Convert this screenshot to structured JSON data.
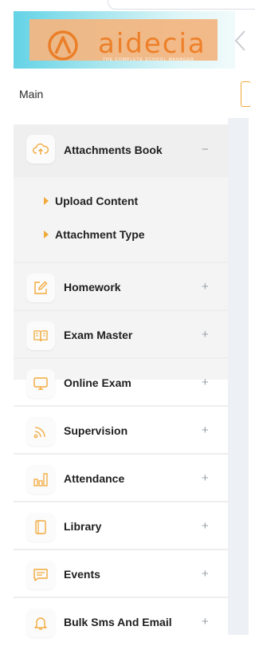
{
  "brand": {
    "name": "aidecia",
    "tagline": "THE COMPLETE SCHOOL MANAGER"
  },
  "main": {
    "label": "Main"
  },
  "menu": {
    "open_group": {
      "label": "Attachments Book",
      "toggle": "−",
      "subitems": [
        "Upload Content",
        "Attachment Type"
      ]
    },
    "items": [
      {
        "label": "Homework",
        "toggle": "+",
        "icon": "pencil-square-icon"
      },
      {
        "label": "Exam Master",
        "toggle": "+",
        "icon": "open-book-icon"
      },
      {
        "label": "Online Exam",
        "toggle": "+",
        "icon": "monitor-icon"
      },
      {
        "label": "Supervision",
        "toggle": "+",
        "icon": "broadcast-icon"
      },
      {
        "label": "Attendance",
        "toggle": "+",
        "icon": "bar-chart-icon"
      },
      {
        "label": "Library",
        "toggle": "+",
        "icon": "book-icon"
      },
      {
        "label": "Events",
        "toggle": "+",
        "icon": "message-icon"
      },
      {
        "label": "Bulk Sms And Email",
        "toggle": "+",
        "icon": "bell-icon"
      }
    ]
  },
  "colors": {
    "accent": "#f2a93b",
    "brand_orange": "#f07a1e",
    "band_cyan": "#63d3e6"
  }
}
